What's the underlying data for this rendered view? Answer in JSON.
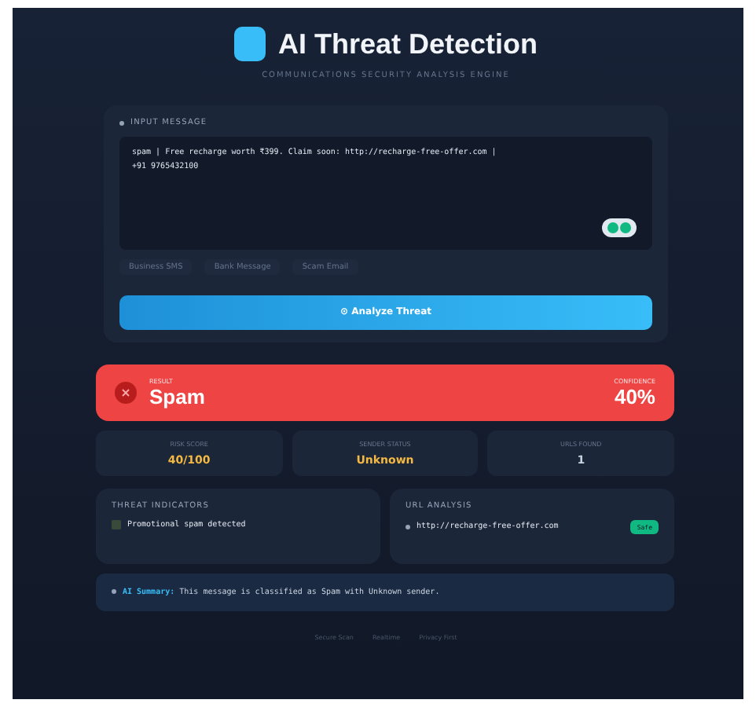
{
  "header": {
    "title": "AI Threat Detection",
    "subtitle": "COMMUNICATIONS SECURITY ANALYSIS ENGINE"
  },
  "input": {
    "label": "INPUT MESSAGE",
    "value": "spam | Free recharge worth ₹399. Claim soon: http://recharge-free-offer.com |\n+91 9765432100",
    "samples": [
      "Business SMS",
      "Bank Message",
      "Scam Email"
    ],
    "button": "⊙ Analyze Threat"
  },
  "result": {
    "label": "RESULT",
    "verdict": "Spam",
    "confidence_label": "CONFIDENCE",
    "confidence": "40%",
    "color": "#ef4444"
  },
  "stats": [
    {
      "label": "RISK SCORE",
      "value": "40/100",
      "color": "#f5b942"
    },
    {
      "label": "SENDER STATUS",
      "value": "Unknown",
      "color": "#f5b942"
    },
    {
      "label": "URLS FOUND",
      "value": "1",
      "color": "#cbd5e1"
    }
  ],
  "indicators": {
    "title": "THREAT INDICATORS",
    "items": [
      {
        "text": "Promotional spam detected",
        "checked": false
      }
    ]
  },
  "urls": {
    "title": "URL ANALYSIS",
    "items": [
      {
        "url": "http://recharge-free-offer.com",
        "status": "Safe",
        "color": "#10b981"
      }
    ]
  },
  "summary": {
    "label": "AI Summary:",
    "text": "This message is classified as Spam with Unknown sender."
  },
  "footer": [
    "Secure Scan",
    "Realtime",
    "Privacy First"
  ]
}
